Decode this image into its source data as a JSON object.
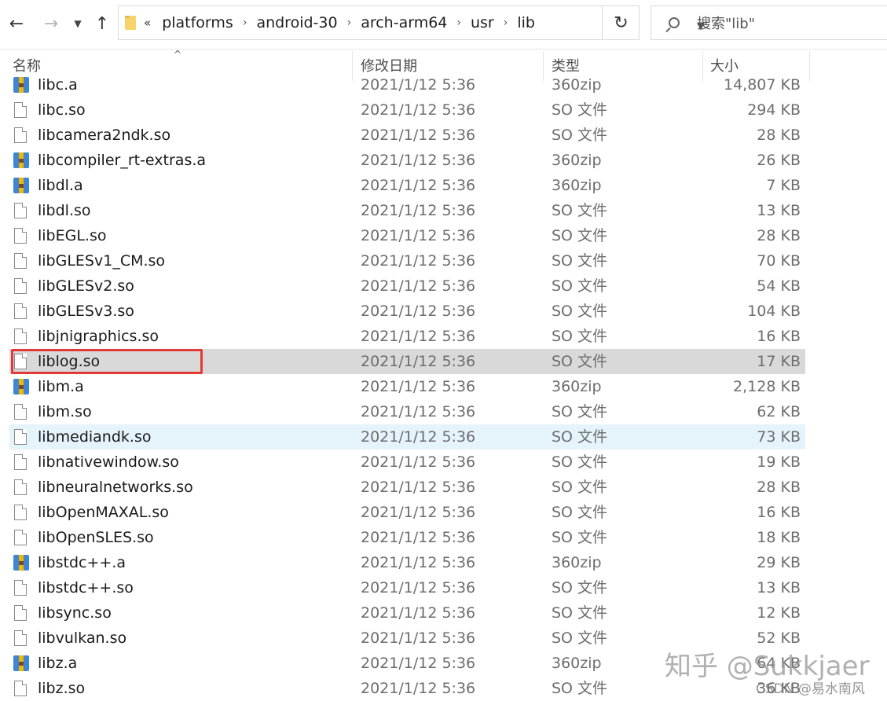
{
  "toolbar": {
    "back_icon": "arrow-left-icon",
    "forward_icon": "arrow-right-icon",
    "recent_icon": "chevron-down-icon",
    "up_icon": "arrow-up-icon",
    "refresh_icon": "refresh-icon"
  },
  "address": {
    "lead": "«",
    "crumbs": [
      "platforms",
      "android-30",
      "arch-arm64",
      "usr",
      "lib"
    ]
  },
  "search": {
    "placeholder": "搜索\"lib\""
  },
  "columns": {
    "name": "名称",
    "date": "修改日期",
    "type": "类型",
    "size": "大小"
  },
  "files": [
    {
      "name": "libc.a",
      "date": "2021/1/12 5:36",
      "type": "360zip",
      "size": "14,807 KB",
      "icon": "zip"
    },
    {
      "name": "libc.so",
      "date": "2021/1/12 5:36",
      "type": "SO 文件",
      "size": "294 KB",
      "icon": "doc"
    },
    {
      "name": "libcamera2ndk.so",
      "date": "2021/1/12 5:36",
      "type": "SO 文件",
      "size": "28 KB",
      "icon": "doc"
    },
    {
      "name": "libcompiler_rt-extras.a",
      "date": "2021/1/12 5:36",
      "type": "360zip",
      "size": "26 KB",
      "icon": "zip"
    },
    {
      "name": "libdl.a",
      "date": "2021/1/12 5:36",
      "type": "360zip",
      "size": "7 KB",
      "icon": "zip"
    },
    {
      "name": "libdl.so",
      "date": "2021/1/12 5:36",
      "type": "SO 文件",
      "size": "13 KB",
      "icon": "doc"
    },
    {
      "name": "libEGL.so",
      "date": "2021/1/12 5:36",
      "type": "SO 文件",
      "size": "28 KB",
      "icon": "doc"
    },
    {
      "name": "libGLESv1_CM.so",
      "date": "2021/1/12 5:36",
      "type": "SO 文件",
      "size": "70 KB",
      "icon": "doc"
    },
    {
      "name": "libGLESv2.so",
      "date": "2021/1/12 5:36",
      "type": "SO 文件",
      "size": "54 KB",
      "icon": "doc"
    },
    {
      "name": "libGLESv3.so",
      "date": "2021/1/12 5:36",
      "type": "SO 文件",
      "size": "104 KB",
      "icon": "doc"
    },
    {
      "name": "libjnigraphics.so",
      "date": "2021/1/12 5:36",
      "type": "SO 文件",
      "size": "16 KB",
      "icon": "doc"
    },
    {
      "name": "liblog.so",
      "date": "2021/1/12 5:36",
      "type": "SO 文件",
      "size": "17 KB",
      "icon": "doc",
      "state": "selected"
    },
    {
      "name": "libm.a",
      "date": "2021/1/12 5:36",
      "type": "360zip",
      "size": "2,128 KB",
      "icon": "zip"
    },
    {
      "name": "libm.so",
      "date": "2021/1/12 5:36",
      "type": "SO 文件",
      "size": "62 KB",
      "icon": "doc"
    },
    {
      "name": "libmediandk.so",
      "date": "2021/1/12 5:36",
      "type": "SO 文件",
      "size": "73 KB",
      "icon": "doc",
      "state": "hover"
    },
    {
      "name": "libnativewindow.so",
      "date": "2021/1/12 5:36",
      "type": "SO 文件",
      "size": "19 KB",
      "icon": "doc"
    },
    {
      "name": "libneuralnetworks.so",
      "date": "2021/1/12 5:36",
      "type": "SO 文件",
      "size": "28 KB",
      "icon": "doc"
    },
    {
      "name": "libOpenMAXAL.so",
      "date": "2021/1/12 5:36",
      "type": "SO 文件",
      "size": "16 KB",
      "icon": "doc"
    },
    {
      "name": "libOpenSLES.so",
      "date": "2021/1/12 5:36",
      "type": "SO 文件",
      "size": "18 KB",
      "icon": "doc"
    },
    {
      "name": "libstdc++.a",
      "date": "2021/1/12 5:36",
      "type": "360zip",
      "size": "29 KB",
      "icon": "zip"
    },
    {
      "name": "libstdc++.so",
      "date": "2021/1/12 5:36",
      "type": "SO 文件",
      "size": "13 KB",
      "icon": "doc"
    },
    {
      "name": "libsync.so",
      "date": "2021/1/12 5:36",
      "type": "SO 文件",
      "size": "12 KB",
      "icon": "doc"
    },
    {
      "name": "libvulkan.so",
      "date": "2021/1/12 5:36",
      "type": "SO 文件",
      "size": "52 KB",
      "icon": "doc"
    },
    {
      "name": "libz.a",
      "date": "2021/1/12 5:36",
      "type": "360zip",
      "size": "64 KB",
      "icon": "zip"
    },
    {
      "name": "libz.so",
      "date": "2021/1/12 5:36",
      "type": "SO 文件",
      "size": "36 KB",
      "icon": "doc"
    }
  ],
  "watermark": {
    "main": "知乎 @Sukkjaer",
    "sub": "CSDN @易水南风"
  }
}
